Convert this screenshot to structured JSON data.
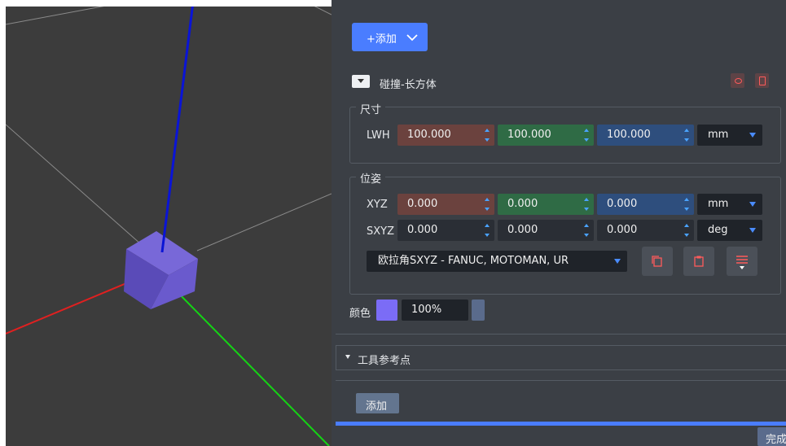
{
  "toolbar": {
    "add_button": "+添加"
  },
  "collision": {
    "section_title": "碰撞-长方体",
    "size": {
      "group_label": "尺寸",
      "row_label": "LWH",
      "values": [
        "100.000",
        "100.000",
        "100.000"
      ],
      "unit": "mm"
    },
    "pose": {
      "group_label": "位姿",
      "xyz": {
        "label": "XYZ",
        "values": [
          "0.000",
          "0.000",
          "0.000"
        ],
        "unit": "mm"
      },
      "sxyz": {
        "label": "SXYZ",
        "values": [
          "0.000",
          "0.000",
          "0.000"
        ],
        "unit": "deg"
      },
      "convention": "欧拉角SXYZ - FANUC, MOTOMAN, UR"
    },
    "color": {
      "label": "颜色",
      "swatch": "#7b6cf6",
      "opacity": "100%"
    }
  },
  "tool_ref": {
    "section_title": "工具参考点"
  },
  "footer": {
    "add_button": "添加",
    "done_button": "完成"
  },
  "colors": {
    "accent": "#4a7dff",
    "x_axis": "#e02020",
    "y_axis": "#14d414",
    "z_axis": "#0a14d6",
    "cube": "#6a5acd"
  }
}
